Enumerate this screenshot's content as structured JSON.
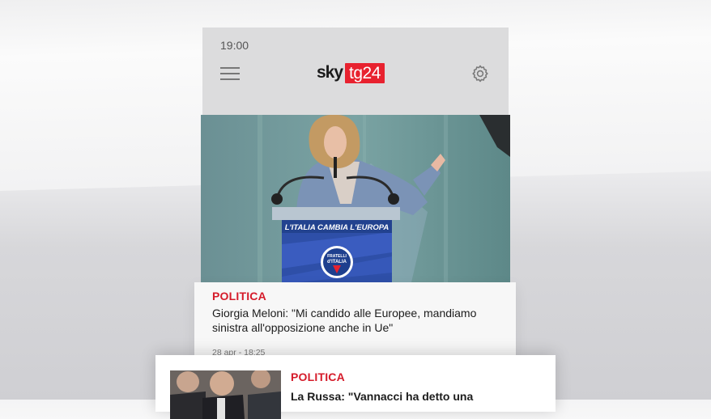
{
  "status_bar": {
    "time": "19:00"
  },
  "header": {
    "logo_sky": "sky",
    "logo_tg": "tg24"
  },
  "hero": {
    "podium_slogan": "L'ITALIA CAMBIA L'EUROPA",
    "badge_line1": "FRATELLI",
    "badge_line2": "d'ITALIA"
  },
  "articles": [
    {
      "category": "POLITICA",
      "title": "Giorgia Meloni: \"Mi candido alle Europee, mandiamo sinistra all'opposizione anche in Ue\"",
      "date": "28 apr - 18:25"
    },
    {
      "category": "POLITICA",
      "title": "La Russa: \"Vannacci ha detto una"
    }
  ],
  "colors": {
    "accent": "#e8222f",
    "category": "#d51b2a"
  }
}
